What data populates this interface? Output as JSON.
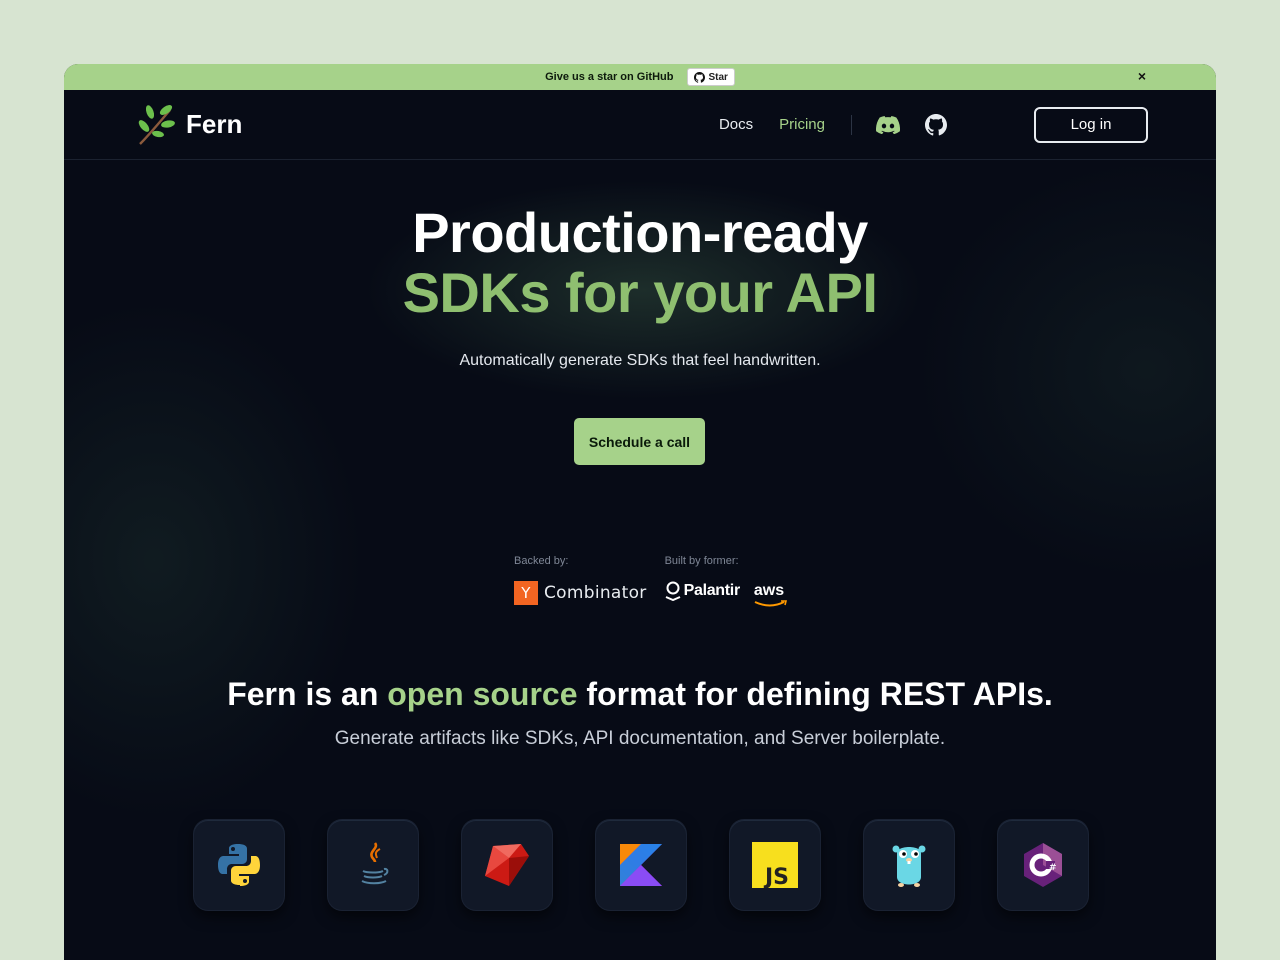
{
  "banner": {
    "message": "Give us a star on GitHub",
    "star_label": "Star",
    "close": "×"
  },
  "nav": {
    "brand": "Fern",
    "links": [
      {
        "label": "Docs"
      },
      {
        "label": "Pricing"
      }
    ],
    "login_label": "Log in"
  },
  "hero": {
    "title_line1": "Production-ready",
    "title_line2": "SDKs for your API",
    "subtitle": "Automatically generate SDKs that feel handwritten.",
    "cta_label": "Schedule a call"
  },
  "backers": {
    "backed_by_label": "Backed by:",
    "built_by_label": "Built by former:",
    "yc_letter": "Y",
    "yc_name": "Combinator",
    "palantir": "Palantir",
    "aws": "aws"
  },
  "section": {
    "title_pre": "Fern is an ",
    "title_highlight": "open source",
    "title_post": " format for defining REST APIs.",
    "subtitle": "Generate artifacts like SDKs, API documentation, and Server boilerplate."
  },
  "languages": [
    "python-icon",
    "java-icon",
    "ruby-icon",
    "kotlin-icon",
    "javascript-icon",
    "go-icon",
    "csharp-icon"
  ],
  "colors": {
    "accent": "#a6d28a",
    "background": "#070b16",
    "page": "#d7e4d1"
  }
}
